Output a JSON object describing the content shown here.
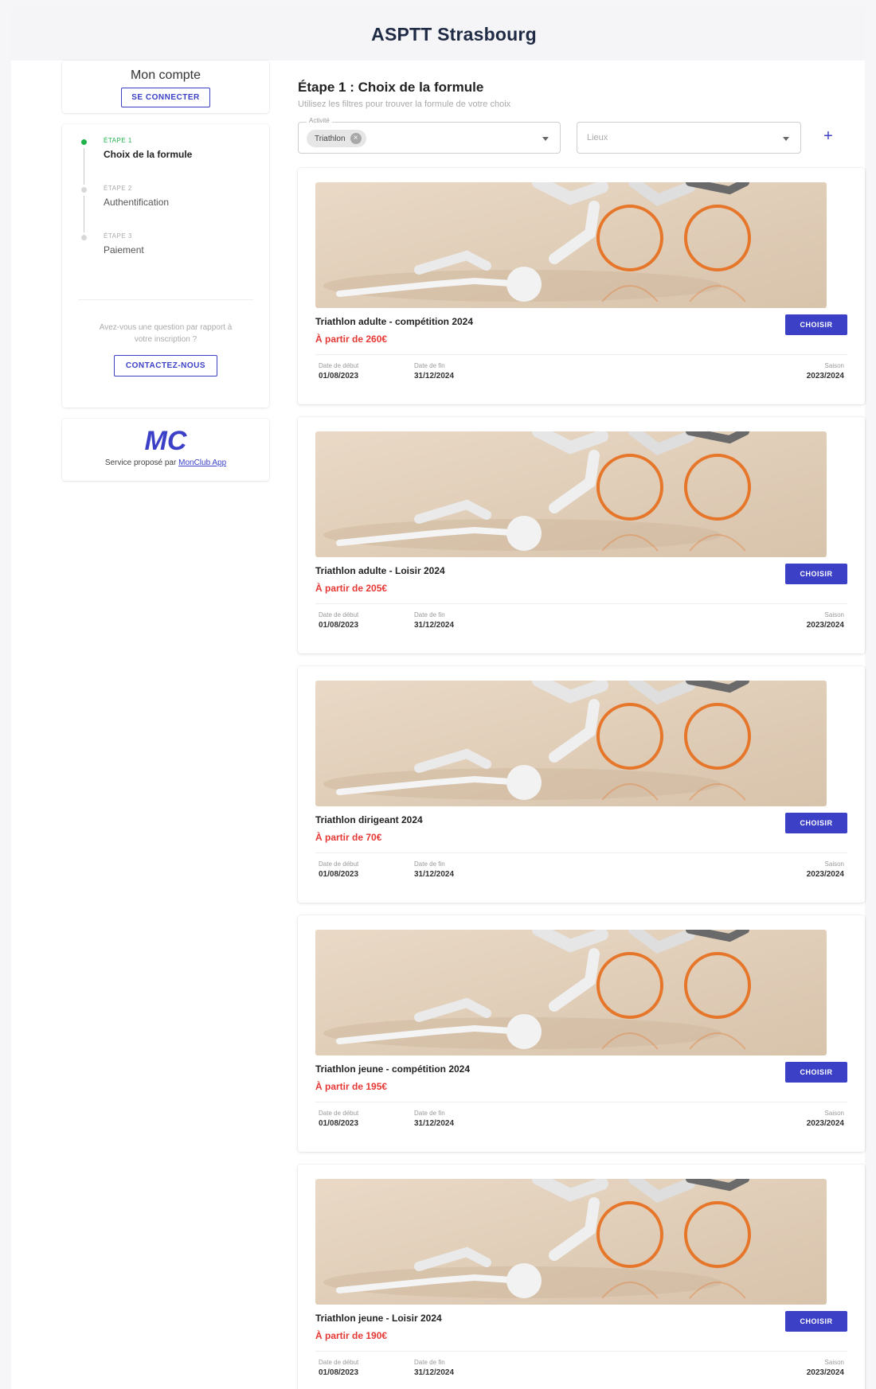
{
  "header": {
    "title": "ASPTT Strasbourg"
  },
  "account": {
    "title": "Mon compte",
    "login_label": "SE CONNECTER"
  },
  "steps": [
    {
      "kicker": "ÉTAPE 1",
      "label": "Choix de la formule",
      "active": true
    },
    {
      "kicker": "ÉTAPE 2",
      "label": "Authentification",
      "active": false
    },
    {
      "kicker": "ÉTAPE 3",
      "label": "Paiement",
      "active": false
    }
  ],
  "help": {
    "text": "Avez-vous une question par rapport à votre inscription ?",
    "contact_label": "CONTACTEZ-NOUS"
  },
  "footer": {
    "logo_text": "MC",
    "service_prefix": "Service proposé par",
    "service_link": "MonClub App"
  },
  "main": {
    "title": "Étape 1 : Choix de la formule",
    "subtitle": "Utilisez les filtres pour trouver la formule de votre choix"
  },
  "filters": {
    "activity_legend": "Activité",
    "activity_chip": "Triathlon",
    "place_placeholder": "Lieux",
    "add_icon": "plus-icon"
  },
  "labels": {
    "choose": "CHOISIR",
    "start": "Date de début",
    "end": "Date de fin",
    "season": "Saison"
  },
  "colors": {
    "accent": "#3b40c7",
    "price": "#e53935",
    "active_step": "#1fb34a"
  },
  "offers": [
    {
      "name": "Triathlon adulte - compétition 2024",
      "price": "À partir de 260€",
      "start": "01/08/2023",
      "end": "31/12/2024",
      "season": "2023/2024"
    },
    {
      "name": "Triathlon adulte - Loisir 2024",
      "price": "À partir de 205€",
      "start": "01/08/2023",
      "end": "31/12/2024",
      "season": "2023/2024"
    },
    {
      "name": "Triathlon dirigeant 2024",
      "price": "À partir de 70€",
      "start": "01/08/2023",
      "end": "31/12/2024",
      "season": "2023/2024"
    },
    {
      "name": "Triathlon jeune - compétition 2024",
      "price": "À partir de 195€",
      "start": "01/08/2023",
      "end": "31/12/2024",
      "season": "2023/2024"
    },
    {
      "name": "Triathlon jeune - Loisir 2024",
      "price": "À partir de 190€",
      "start": "01/08/2023",
      "end": "31/12/2024",
      "season": "2023/2024"
    }
  ]
}
